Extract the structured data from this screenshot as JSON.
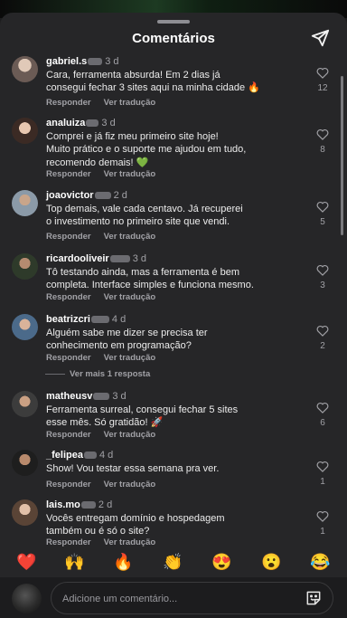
{
  "header": {
    "title": "Comentários"
  },
  "actions": {
    "reply": "Responder",
    "translate": "Ver tradução"
  },
  "comments": [
    {
      "user": "gabriel.s",
      "time": "3 d",
      "lines": [
        "Cara, ferramenta absurda! Em 2 dias já",
        "consegui fechar 3 sites aqui na minha cidade 🔥"
      ],
      "likes": "12"
    },
    {
      "user": "analuiza",
      "time": "3 d",
      "lines": [
        "Comprei e já fiz meu primeiro site hoje!",
        "Muito prático e o suporte me ajudou em tudo,",
        "recomendo demais! 💚"
      ],
      "likes": "8"
    },
    {
      "user": "joaovictor",
      "time": "2 d",
      "lines": [
        "Top demais, vale cada centavo. Já recuperei",
        "o investimento no primeiro site que vendi."
      ],
      "likes": "5"
    },
    {
      "user": "ricardooliveir",
      "time": "3 d",
      "lines": [
        "Tô testando ainda, mas a ferramenta é bem",
        "completa. Interface simples e funciona mesmo."
      ],
      "likes": "3"
    },
    {
      "user": "beatrizcri",
      "time": "4 d",
      "lines": [
        "Alguém sabe me dizer se precisa ter",
        "conhecimento em programação?"
      ],
      "likes": "2"
    },
    {
      "user": "matheusv",
      "time": "3 d",
      "lines": [
        "Ferramenta surreal, consegui fechar 5 sites",
        "esse mês. Só gratidão! 🚀"
      ],
      "likes": "6"
    },
    {
      "user": "_felipea",
      "time": "4 d",
      "lines": [
        "Show! Vou testar essa semana pra ver."
      ],
      "likes": "1"
    },
    {
      "user": "lais.mo",
      "time": "2 d",
      "lines": [
        "Vocês entregam domínio e hospedagem",
        "também ou é só o site?"
      ],
      "likes": "1"
    }
  ],
  "more_replies": "Ver mais 1 resposta",
  "emojis": [
    "❤️",
    "🙌",
    "🔥",
    "👏",
    "😍",
    "😮",
    "😂"
  ],
  "input": {
    "placeholder": "Adicione um comentário..."
  }
}
